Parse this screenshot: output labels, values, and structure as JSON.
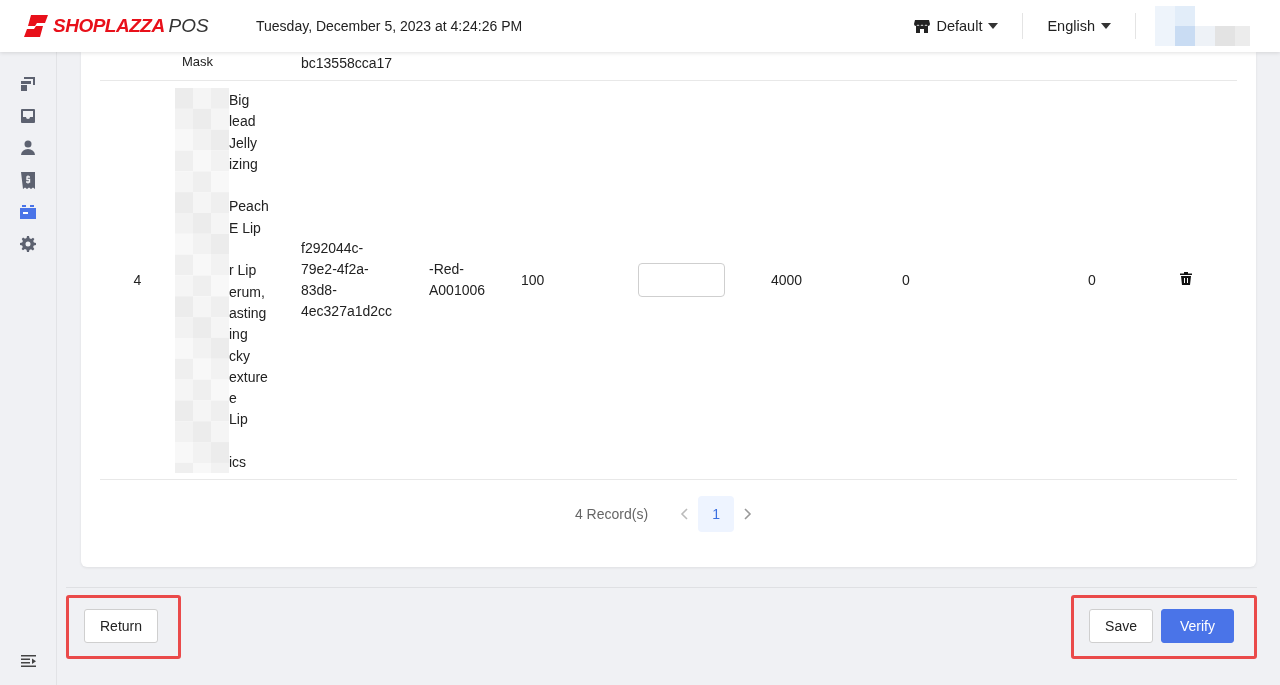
{
  "header": {
    "logo": {
      "brand": "SHOPLAZZA",
      "product": "POS"
    },
    "datetime": "Tuesday, December 5, 2023 at 4:24:26 PM",
    "store_menu": {
      "label": "Default"
    },
    "language_menu": {
      "label": "English"
    }
  },
  "sidebar": {
    "items": [
      {
        "kind": "cards",
        "selected": false
      },
      {
        "kind": "inbox",
        "selected": false
      },
      {
        "kind": "person",
        "selected": false
      },
      {
        "kind": "receipt",
        "selected": false
      },
      {
        "kind": "box",
        "selected": true
      },
      {
        "kind": "settings",
        "selected": false
      }
    ]
  },
  "table": {
    "rows": [
      {
        "kind": "partial",
        "column_2": "Mask",
        "column_3": "bc13558cca17"
      },
      {
        "kind": "full",
        "column_1": "4",
        "column_2": "Big\nlead\nJelly\nizing\n\nPeach\nE Lip\n\nr Lip\nerum,\nasting\ning\ncky\nexture\ne\nLip\n\nics",
        "column_3": "f292044c-\n79e2-4f2a-\n83d8-\n4ec327a1d2cc",
        "column_4": "-Red-\nA001006",
        "column_5": "100",
        "column_7": "4000",
        "column_8": "0",
        "column_9": "0"
      }
    ]
  },
  "pagination": {
    "total": "4 Record(s)",
    "pages": [
      {
        "label": "1",
        "selected": true
      }
    ]
  },
  "footer": {
    "groups": [
      {
        "highlighted": true,
        "buttons": [
          {
            "label": "Return",
            "kind": "default"
          }
        ]
      },
      {
        "highlighted": true,
        "buttons": [
          {
            "label": "Save",
            "kind": "default"
          },
          {
            "label": "Verify",
            "kind": "primary"
          }
        ]
      }
    ]
  }
}
